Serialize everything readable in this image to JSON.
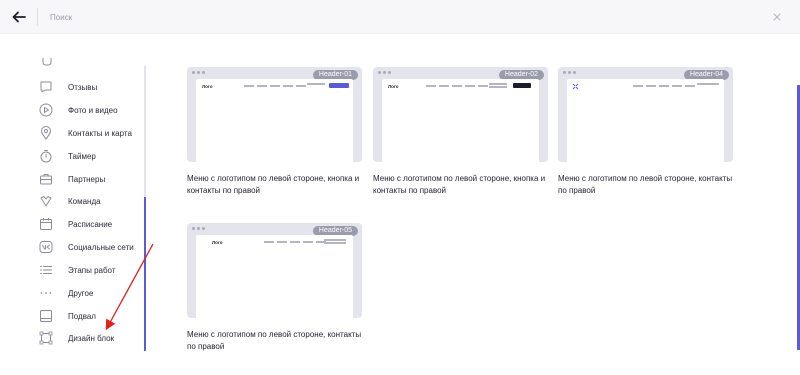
{
  "header": {
    "search_placeholder": "Поиск"
  },
  "sidebar": {
    "items": [
      {
        "label": "Отзывы"
      },
      {
        "label": "Фото и видео"
      },
      {
        "label": "Контакты и карта"
      },
      {
        "label": "Таймер"
      },
      {
        "label": "Партнеры"
      },
      {
        "label": "Команда"
      },
      {
        "label": "Расписание"
      },
      {
        "label": "Социальные сети"
      },
      {
        "label": "Этапы работ"
      },
      {
        "label": "Другое"
      },
      {
        "label": "Подвал"
      },
      {
        "label": "Дизайн блок"
      }
    ]
  },
  "cards": [
    {
      "tag": "Header-01",
      "logo": "Лого",
      "description": "Меню с логотипом по левой стороне, кнопка и контакты по правой"
    },
    {
      "tag": "Header-02",
      "logo": "Лого",
      "description": "Меню с логотипом по левой стороне, кнопка и контакты по правой"
    },
    {
      "tag": "Header-04",
      "logo": "",
      "description": "Меню с логотипом по левой стороне, контакты по правой"
    },
    {
      "tag": "Header-05",
      "logo": "Лого",
      "description": "Меню с логотипом по левой стороне, контакты по правой"
    }
  ],
  "colors": {
    "accent": "#5b5bd6",
    "annotation_arrow": "#e0201b"
  }
}
